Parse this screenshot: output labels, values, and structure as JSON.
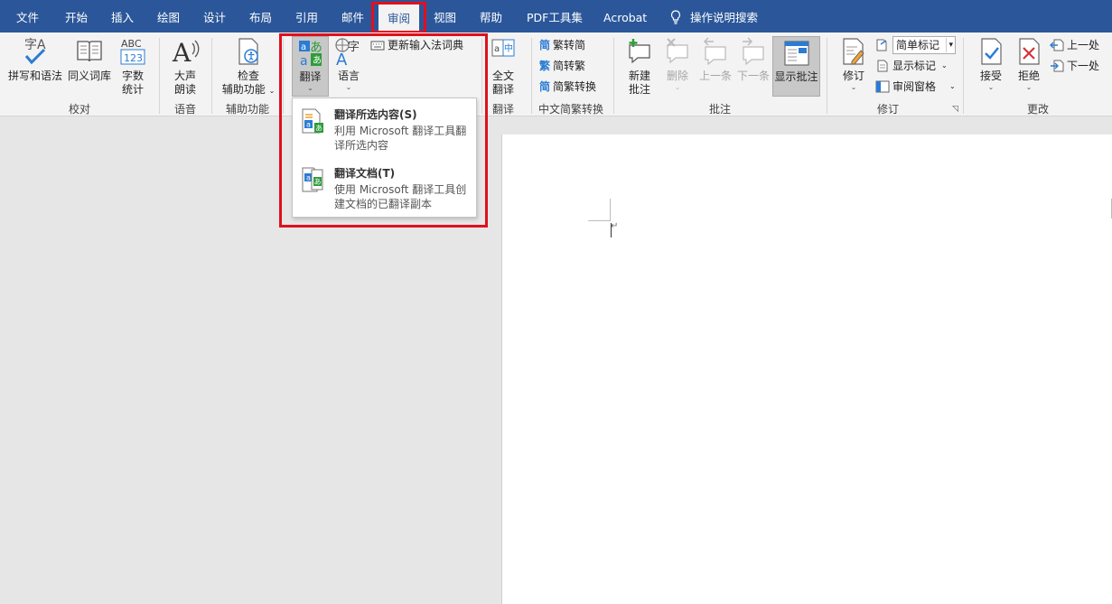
{
  "tabs": [
    "文件",
    "开始",
    "插入",
    "绘图",
    "设计",
    "布局",
    "引用",
    "邮件",
    "审阅",
    "视图",
    "帮助",
    "PDF工具集",
    "Acrobat",
    "操作说明搜索"
  ],
  "ribbon": {
    "proofing": {
      "spelling": "拼写和语法",
      "thesaurus": "同义词库",
      "wordcount_1": "字数",
      "wordcount_2": "统计",
      "group": "校对"
    },
    "speech": {
      "read_1": "大声",
      "read_2": "朗读",
      "group": "语音"
    },
    "accessibility": {
      "check_1": "检查",
      "check_2": "辅助功能",
      "group": "辅助功能"
    },
    "language": {
      "translate": "翻译",
      "language": "语言",
      "update_ime": "更新输入法词典"
    },
    "fulltext": {
      "label_1": "全文",
      "label_2": "翻译",
      "group": "翻译",
      "abc": "ABC",
      "num": "123"
    },
    "chinese": {
      "t2s": "繁转简",
      "s2t": "简转繁",
      "convert": "简繁转换",
      "group": "中文简繁转换"
    },
    "comments": {
      "new_1": "新建",
      "new_2": "批注",
      "delete": "删除",
      "prev": "上一条",
      "next": "下一条",
      "show": "显示批注",
      "group": "批注"
    },
    "tracking": {
      "track": "修订",
      "markup_select": "简单标记",
      "show_markup": "显示标记",
      "pane": "审阅窗格",
      "group": "修订"
    },
    "changes": {
      "accept": "接受",
      "reject": "拒绝",
      "prev": "上一处",
      "next": "下一处",
      "group": "更改"
    }
  },
  "dropdown": {
    "item1_title": "翻译所选内容(S)",
    "item1_desc": "利用 Microsoft 翻译工具翻译所选内容",
    "item2_title": "翻译文档(T)",
    "item2_desc": "使用 Microsoft 翻译工具创建文档的已翻译副本"
  },
  "colors": {
    "tabbar": "#2b579a",
    "highlight": "#e0101d",
    "ribbon": "#f3f3f3"
  }
}
